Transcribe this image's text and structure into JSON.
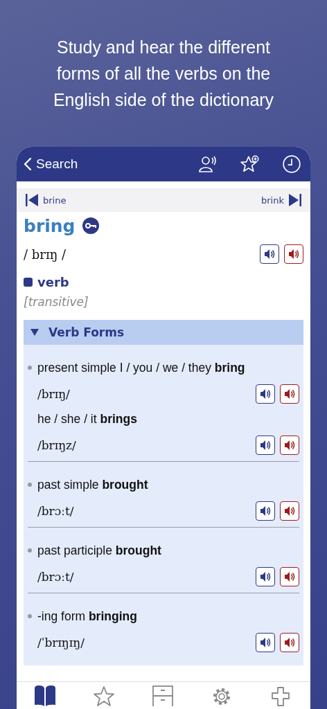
{
  "headline": "Study and hear the different forms of all the verbs on the English side of the dictionary",
  "nav": {
    "back_label": "Search"
  },
  "entry_nav": {
    "previous": "brine",
    "next": "brink"
  },
  "entry": {
    "headword": "bring",
    "pronunciation": "/ brɪŋ /",
    "part_of_speech": "verb",
    "grammar": "[transitive]"
  },
  "verb_forms": {
    "title": "Verb Forms",
    "expanded": true,
    "groups": [
      {
        "entries": [
          {
            "label": "present simple I / you / we / they **bring**",
            "pronunciation": "/brɪŋ/"
          },
          {
            "label": "he / she / it **brings**",
            "pronunciation": "/brɪŋz/"
          }
        ]
      },
      {
        "entries": [
          {
            "label": "past simple **brought**",
            "pronunciation": "/brɔːt/"
          }
        ]
      },
      {
        "entries": [
          {
            "label": "past participle **brought**",
            "pronunciation": "/brɔːt/"
          }
        ]
      },
      {
        "entries": [
          {
            "label": "-ing form **bringing**",
            "pronunciation": "/ˈbrɪŋɪŋ/"
          }
        ]
      }
    ]
  },
  "tab_bar": [
    {
      "selected": true
    },
    {
      "selected": false
    },
    {
      "selected": false
    },
    {
      "selected": false
    },
    {
      "selected": false
    }
  ]
}
